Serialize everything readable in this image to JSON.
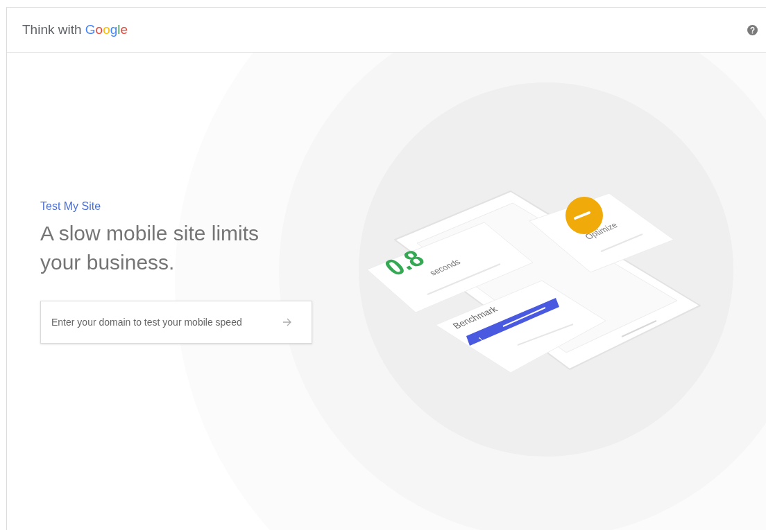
{
  "header": {
    "logo": {
      "prefix": "Think with",
      "brand": "Google"
    }
  },
  "hero": {
    "eyebrow": "Test My Site",
    "headline": "A slow mobile site limits your business.",
    "domain_field": {
      "placeholder": "Enter your domain to test your mobile speed"
    }
  },
  "illustration": {
    "speed_card": {
      "value": "0.8",
      "unit": "seconds"
    },
    "optimize_card": {
      "label": "Optimize"
    },
    "benchmark_card": {
      "title": "Benchmark",
      "rank": "1"
    }
  }
}
